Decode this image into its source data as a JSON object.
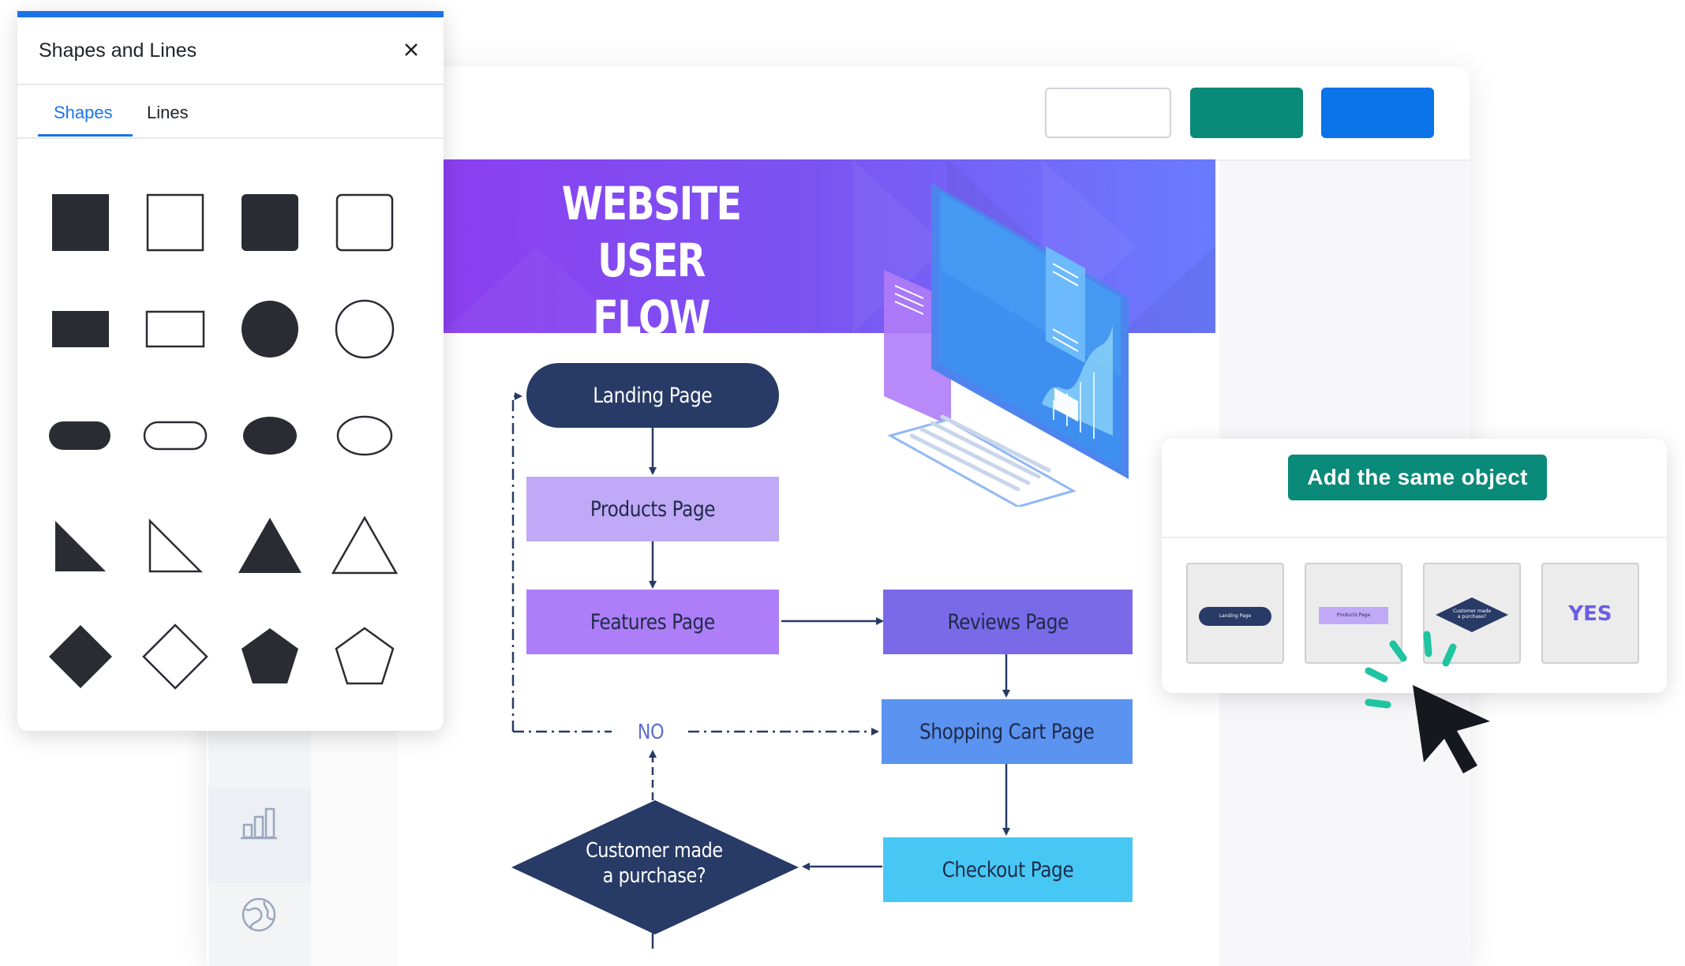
{
  "toolbar": {
    "buttons": [
      "",
      "",
      ""
    ],
    "colors": {
      "outline": "#cfd3d9",
      "teal": "#0a8a78",
      "blue": "#0a74e8"
    }
  },
  "sidebar": {
    "icons": [
      "bar-chart-icon",
      "globe-icon"
    ]
  },
  "shapes_panel": {
    "title": "Shapes and Lines",
    "close_icon": "close-icon",
    "tabs": [
      {
        "label": "Shapes",
        "active": true
      },
      {
        "label": "Lines",
        "active": false
      }
    ],
    "shapes": [
      "square-filled",
      "square-outline",
      "rounded-square-filled",
      "rounded-square-outline",
      "rectangle-filled",
      "rectangle-outline",
      "circle-filled",
      "circle-outline",
      "pill-filled",
      "pill-outline",
      "ellipse-filled",
      "ellipse-outline",
      "right-triangle-filled",
      "right-triangle-outline",
      "triangle-filled",
      "triangle-outline",
      "diamond-filled",
      "diamond-outline",
      "pentagon-filled",
      "pentagon-outline"
    ],
    "accent": "#1a73e8"
  },
  "diagram": {
    "title_line1": "WEBSITE USER",
    "title_line2": "FLOW DIAGRAM",
    "nodes": {
      "landing": "Landing Page",
      "products": "Products Page",
      "features": "Features Page",
      "reviews": "Reviews Page",
      "cart": "Shopping Cart Page",
      "checkout": "Checkout Page",
      "decision_line1": "Customer made",
      "decision_line2": "a purchase?",
      "no_label": "NO"
    },
    "colors": {
      "navy": "#283a66",
      "lavender": "#c0a9f6",
      "violet": "#ad7ef8",
      "indigo": "#7a6ae8",
      "blue": "#5b93f0",
      "cyan": "#47c8f4",
      "banner_start": "#8b3ff0",
      "banner_end": "#6a7bff"
    }
  },
  "add_same_object": {
    "button_label": "Add the same object",
    "thumbnails": [
      {
        "kind": "pill",
        "text": "Landing Page"
      },
      {
        "kind": "rectangle",
        "text": "Products Page"
      },
      {
        "kind": "diamond",
        "text_line1": "Customer made",
        "text_line2": "a purchase?"
      },
      {
        "kind": "text",
        "text": "YES"
      }
    ]
  }
}
